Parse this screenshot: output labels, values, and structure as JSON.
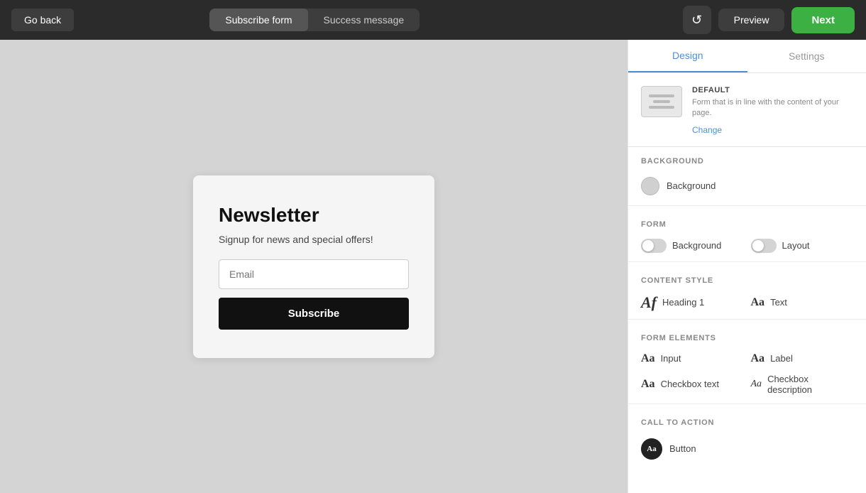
{
  "topbar": {
    "go_back_label": "Go back",
    "tab_subscribe": "Subscribe form",
    "tab_success": "Success message",
    "history_icon": "↺",
    "preview_label": "Preview",
    "next_label": "Next"
  },
  "canvas": {
    "newsletter": {
      "title": "Newsletter",
      "subtitle": "Signup for news and special offers!",
      "email_placeholder": "Email",
      "subscribe_label": "Subscribe"
    }
  },
  "right_panel": {
    "tab_design": "Design",
    "tab_settings": "Settings",
    "default_section": {
      "label": "DEFAULT",
      "description": "Form that is in line with the content of your page.",
      "change_link": "Change"
    },
    "background_section": {
      "header": "BACKGROUND",
      "background_label": "Background"
    },
    "form_section": {
      "header": "FORM",
      "background_label": "Background",
      "layout_label": "Layout"
    },
    "content_style_section": {
      "header": "CONTENT STYLE",
      "heading_label": "Heading 1",
      "text_label": "Text"
    },
    "form_elements_section": {
      "header": "FORM ELEMENTS",
      "input_label": "Input",
      "label_label": "Label",
      "checkbox_text_label": "Checkbox text",
      "checkbox_desc_label": "Checkbox description"
    },
    "call_to_action_section": {
      "header": "CALL TO ACTION",
      "button_label": "Button",
      "avatar_text": "Aa"
    }
  }
}
